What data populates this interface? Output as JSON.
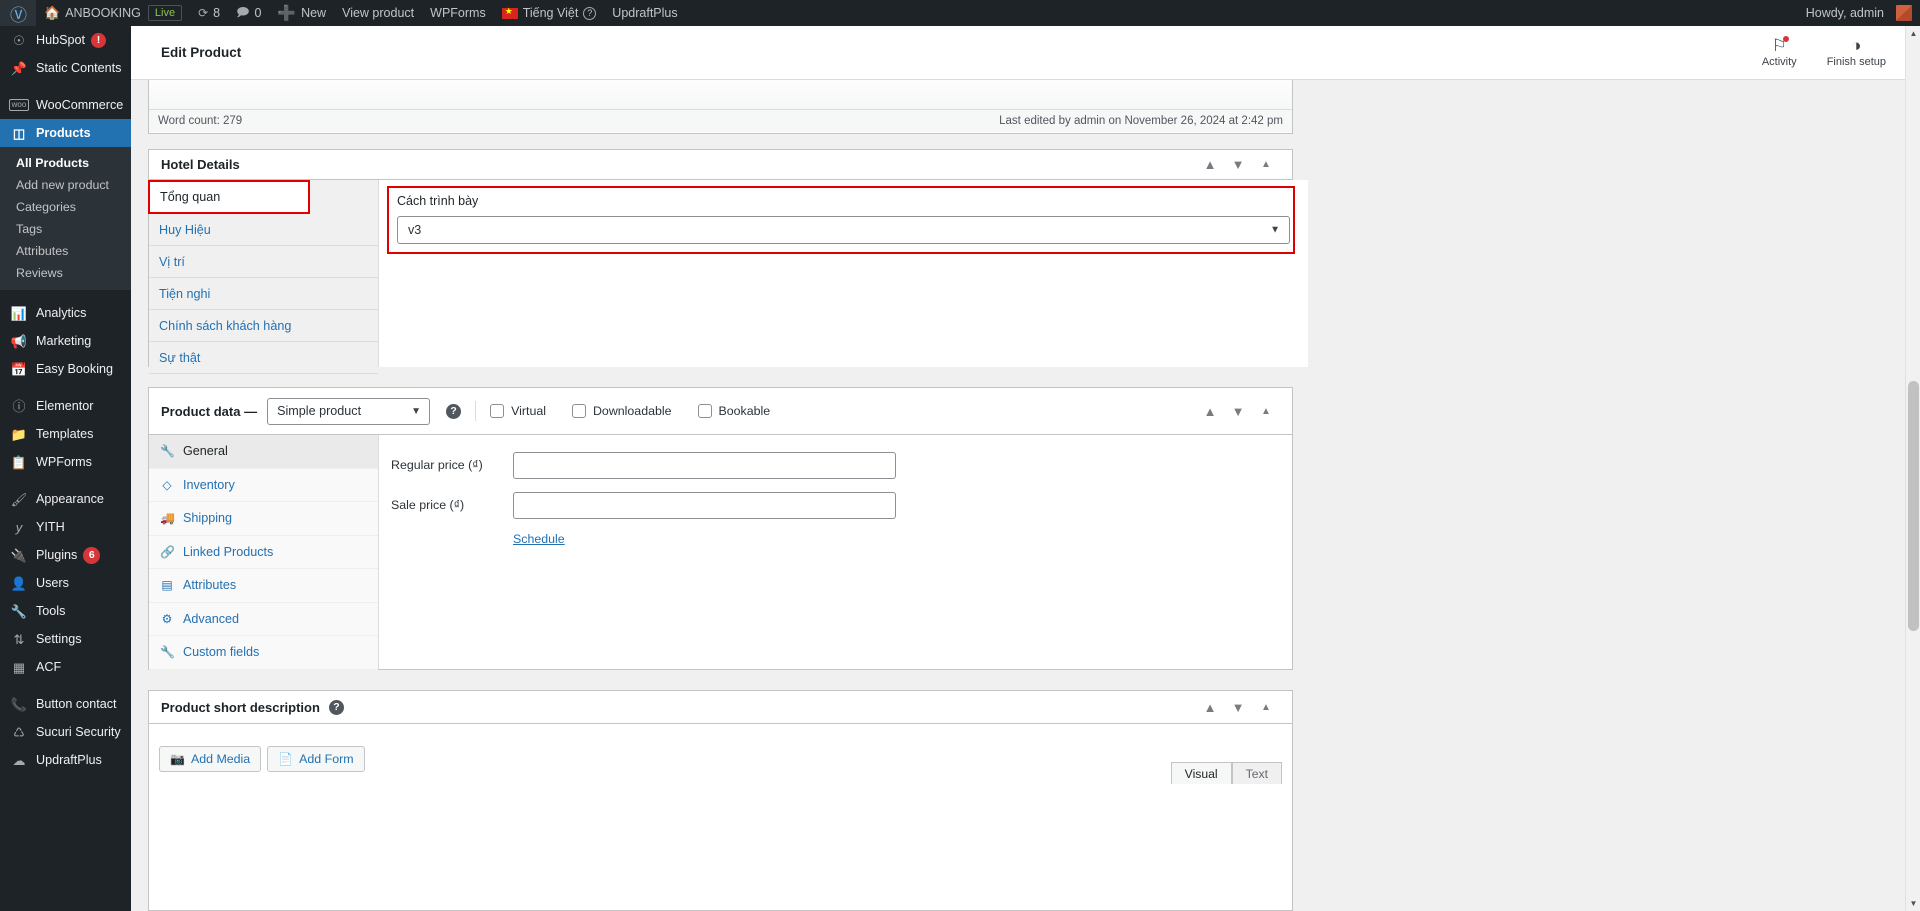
{
  "adminbar": {
    "wp_logo": "wordpress-logo",
    "site_name": "ANBOOKING",
    "live_badge": "Live",
    "updates_count": "8",
    "comments_count": "0",
    "new_label": "New",
    "view_product": "View product",
    "wpforms": "WPForms",
    "language": "Tiếng Việt",
    "updraftplus": "UpdraftPlus",
    "howdy": "Howdy, admin"
  },
  "sidebar": {
    "items": [
      {
        "label": "HubSpot",
        "icon": "hubspot-icon",
        "badge": "!",
        "badge_type": "alert"
      },
      {
        "label": "Static Contents",
        "icon": "pin-icon"
      },
      {
        "label": "WooCommerce",
        "icon": "woo-icon",
        "sep_before": true
      },
      {
        "label": "Products",
        "icon": "products-icon",
        "current": true
      },
      {
        "label": "Analytics",
        "icon": "chart-icon",
        "sep_before": true
      },
      {
        "label": "Marketing",
        "icon": "megaphone-icon"
      },
      {
        "label": "Easy Booking",
        "icon": "calendar-icon"
      },
      {
        "label": "Elementor",
        "icon": "elementor-icon",
        "sep_before": true
      },
      {
        "label": "Templates",
        "icon": "folder-icon"
      },
      {
        "label": "WPForms",
        "icon": "form-icon"
      },
      {
        "label": "Appearance",
        "icon": "brush-icon",
        "sep_before": true
      },
      {
        "label": "YITH",
        "icon": "yith-icon"
      },
      {
        "label": "Plugins",
        "icon": "plug-icon",
        "badge": "6"
      },
      {
        "label": "Users",
        "icon": "user-icon"
      },
      {
        "label": "Tools",
        "icon": "wrench-icon"
      },
      {
        "label": "Settings",
        "icon": "sliders-icon"
      },
      {
        "label": "ACF",
        "icon": "acf-icon"
      },
      {
        "label": "Button contact",
        "icon": "phone-icon",
        "sep_before": true
      },
      {
        "label": "Sucuri Security",
        "icon": "shield-icon"
      },
      {
        "label": "UpdraftPlus",
        "icon": "cloud-icon"
      }
    ],
    "products_submenu": [
      {
        "label": "All Products",
        "current": true
      },
      {
        "label": "Add new product"
      },
      {
        "label": "Categories"
      },
      {
        "label": "Tags"
      },
      {
        "label": "Attributes"
      },
      {
        "label": "Reviews"
      }
    ]
  },
  "wooheader": {
    "title": "Edit Product",
    "activity_label": "Activity",
    "finish_setup_label": "Finish setup"
  },
  "editor": {
    "word_count": "Word count: 279",
    "last_edited": "Last edited by admin on November 26, 2024 at 2:42 pm"
  },
  "hotel_details": {
    "title": "Hotel Details",
    "tabs": [
      {
        "label": "Tổng quan",
        "active": true,
        "highlighted": true
      },
      {
        "label": "Huy Hiệu"
      },
      {
        "label": "Vị trí"
      },
      {
        "label": "Tiện nghi"
      },
      {
        "label": "Chính sách khách hàng"
      },
      {
        "label": "Sự thật"
      }
    ],
    "field_label": "Cách trình bày",
    "field_value": "v3",
    "highlight_color": "#e00000"
  },
  "product_data": {
    "title": "Product data —",
    "type_value": "Simple product",
    "checkboxes": [
      {
        "label": "Virtual",
        "checked": false
      },
      {
        "label": "Downloadable",
        "checked": false
      },
      {
        "label": "Bookable",
        "checked": false
      }
    ],
    "tabs": [
      {
        "label": "General",
        "icon": "wrench-icon",
        "active": true
      },
      {
        "label": "Inventory",
        "icon": "box-icon"
      },
      {
        "label": "Shipping",
        "icon": "truck-icon"
      },
      {
        "label": "Linked Products",
        "icon": "link-icon"
      },
      {
        "label": "Attributes",
        "icon": "attributes-icon"
      },
      {
        "label": "Advanced",
        "icon": "gear-icon"
      },
      {
        "label": "Custom fields",
        "icon": "wrench-icon"
      }
    ],
    "fields": [
      {
        "label": "Regular price (₫)",
        "value": ""
      },
      {
        "label": "Sale price (₫)",
        "value": ""
      }
    ],
    "schedule_link": "Schedule"
  },
  "short_description": {
    "title": "Product short description",
    "add_media": "Add Media",
    "add_form": "Add Form",
    "visual_tab": "Visual",
    "text_tab": "Text"
  }
}
